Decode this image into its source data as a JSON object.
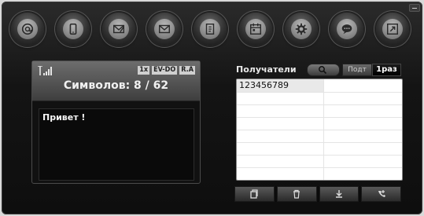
{
  "toolbar": {
    "icons": [
      {
        "name": "email-at-icon"
      },
      {
        "name": "mobile-phone-icon"
      },
      {
        "name": "write-message-icon"
      },
      {
        "name": "inbox-envelope-icon"
      },
      {
        "name": "phonebook-icon"
      },
      {
        "name": "calendar-icon"
      },
      {
        "name": "settings-gear-icon"
      },
      {
        "name": "chat-bubble-icon"
      },
      {
        "name": "export-icon"
      }
    ]
  },
  "phone": {
    "badges": [
      "1x",
      "EV-DO",
      "R.A"
    ],
    "chars_text": "Символов: 8 / 62",
    "message": "Привет !"
  },
  "recipients": {
    "label": "Получатели",
    "tab_a": "Подт",
    "tab_b": "1раз",
    "rows": [
      "123456789",
      "",
      "",
      "",
      "",
      "",
      "",
      ""
    ]
  },
  "actions": [
    {
      "name": "send-sim-icon"
    },
    {
      "name": "delete-trash-icon"
    },
    {
      "name": "download-icon"
    },
    {
      "name": "add-contact-icon"
    }
  ],
  "colors": {
    "accent": "#bdbdbd",
    "background": "#141414",
    "table_bg": "#ffffff"
  }
}
